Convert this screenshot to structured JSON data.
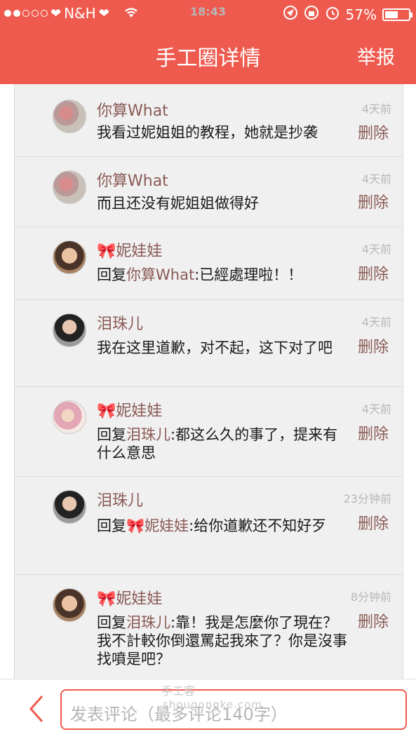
{
  "status_bar": {
    "carrier": "N&H",
    "time": "18:43",
    "battery": "57%",
    "battery_level": 0.57
  },
  "nav": {
    "title": "手工圈详情",
    "report_label": "举报"
  },
  "comments": [
    {
      "author": "你算What",
      "time": "4天前",
      "delete": "删除",
      "text": "我看过妮姐姐的教程，她就是抄袭",
      "avatar": "avatar-1"
    },
    {
      "author": "你算What",
      "time": "4天前",
      "delete": "删除",
      "text": "而且还没有妮姐姐做得好",
      "avatar": "avatar-1"
    },
    {
      "author": "🎀妮娃娃",
      "time": "4天前",
      "delete": "删除",
      "reply_prefix": "回复",
      "reply_to": "你算What",
      "text": ":已經處理啦！！",
      "avatar": "avatar-2"
    },
    {
      "author": "泪珠儿",
      "time": "4天前",
      "delete": "删除",
      "text": "我在这里道歉，对不起，这下对了吧",
      "avatar": "avatar-3"
    },
    {
      "author": "🎀妮娃娃",
      "time": "4天前",
      "delete": "删除",
      "reply_prefix": "回复",
      "reply_to": "泪珠儿",
      "text": ":都这么久的事了，提来有什么意思",
      "avatar": "avatar-4"
    },
    {
      "author": "泪珠儿",
      "time": "23分钟前",
      "delete": "删除",
      "reply_prefix": "回复",
      "reply_to": "🎀妮娃娃",
      "text": ":给你道歉还不知好歹",
      "avatar": "avatar-3"
    },
    {
      "author": "🎀妮娃娃",
      "time": "8分钟前",
      "delete": "删除",
      "reply_prefix": "回复",
      "reply_to": "泪珠儿",
      "text": ":靠！我是怎麼你了現在？我不計較你倒還罵起我來了？你是沒事找噴是吧？",
      "avatar": "avatar-2"
    }
  ],
  "bottom": {
    "placeholder": "发表评论（最多评论140字）",
    "watermark": "手工客",
    "watermark_url": "shougongke.com"
  }
}
